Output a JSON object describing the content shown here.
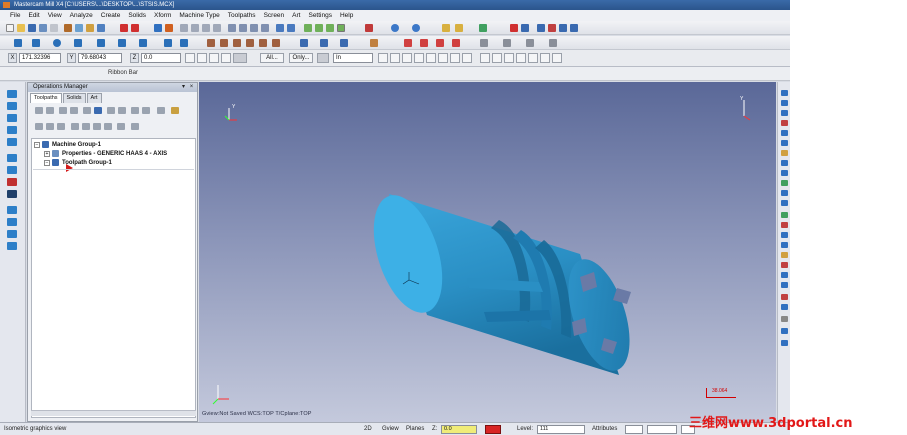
{
  "window": {
    "title": "Mastercam Mill X4 [C:\\USERS\\...\\DESKTOP\\...\\STSIS.MCX]"
  },
  "menu": [
    "File",
    "Edit",
    "View",
    "Analyze",
    "Create",
    "Solids",
    "Xform",
    "Machine Type",
    "Toolpaths",
    "Screen",
    "Art",
    "Settings",
    "Help"
  ],
  "coords": {
    "x_label": "X",
    "x_value": "171.32396",
    "y_label": "Y",
    "y_value": "79.68043",
    "z_label": "Z",
    "z_value": "0.0",
    "all_button": "All...",
    "only_button": "Only...",
    "mode_value": "In"
  },
  "ribbon": {
    "label": "Ribbon Bar"
  },
  "ops_manager": {
    "title": "Operations Manager",
    "tabs": [
      "Toolpaths",
      "Solids",
      "Art"
    ],
    "tree": {
      "machine_group": "Machine Group-1",
      "properties": "Properties - GENERIC HAAS 4 - AXIS",
      "toolpath_group": "Toolpath Group-1"
    }
  },
  "viewport": {
    "info_text": "Gview:Not Saved   WCS:TOP   T/Cplane:TOP",
    "scale_value": "38.064",
    "part_color": "#2a8fc4",
    "background_top": "#5a6898",
    "background_bottom": "#c4c9dc"
  },
  "status": {
    "left_text": "Isometric graphics view",
    "mode_2d": "2D",
    "gview": "Gview",
    "planes": "Planes",
    "z_label": "Z:",
    "z_value": "0.0",
    "level_label": "Level:",
    "level_value": "111",
    "attributes": "Attributes"
  },
  "watermark": {
    "text": "三维网www.3dportal.cn",
    "color": "#e21818"
  }
}
